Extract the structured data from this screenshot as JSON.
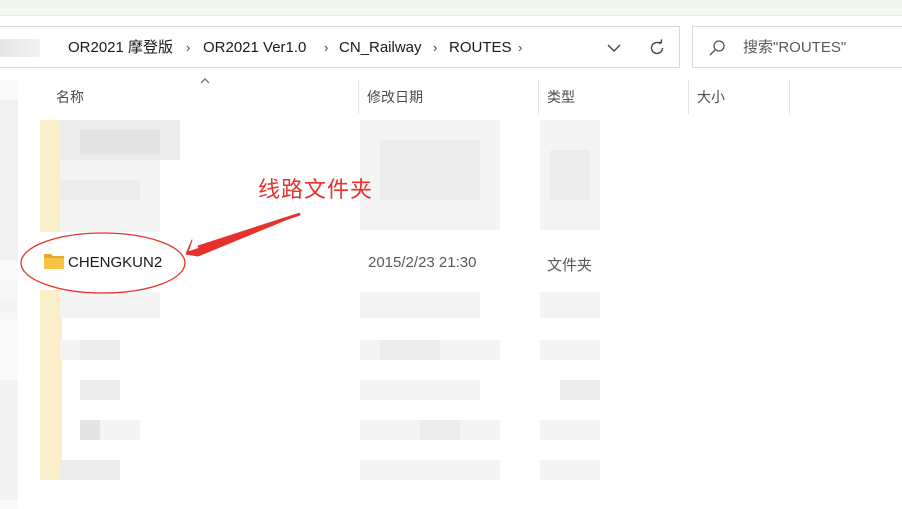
{
  "address_bar": {
    "crumbs": [
      "OR2021 摩登版",
      "OR2021 Ver1.0",
      "CN_Railway",
      "ROUTES"
    ],
    "separator": "›"
  },
  "search": {
    "placeholder": "搜索\"ROUTES\""
  },
  "columns": {
    "name": "名称",
    "modified": "修改日期",
    "type": "类型",
    "size": "大小"
  },
  "rows": [
    {
      "name": "CHENGKUN2",
      "modified": "2015/2/23 21:30",
      "type": "文件夹",
      "size": ""
    }
  ],
  "annotation": {
    "label": "线路文件夹",
    "color": "#e5322d"
  },
  "icons": {
    "back": "chevron-down-icon",
    "refresh": "refresh-icon",
    "search": "search-icon",
    "folder": "folder-icon"
  },
  "colors": {
    "folder": "#f5c542",
    "annotation": "#e5322d",
    "border": "#d9d9d9"
  }
}
